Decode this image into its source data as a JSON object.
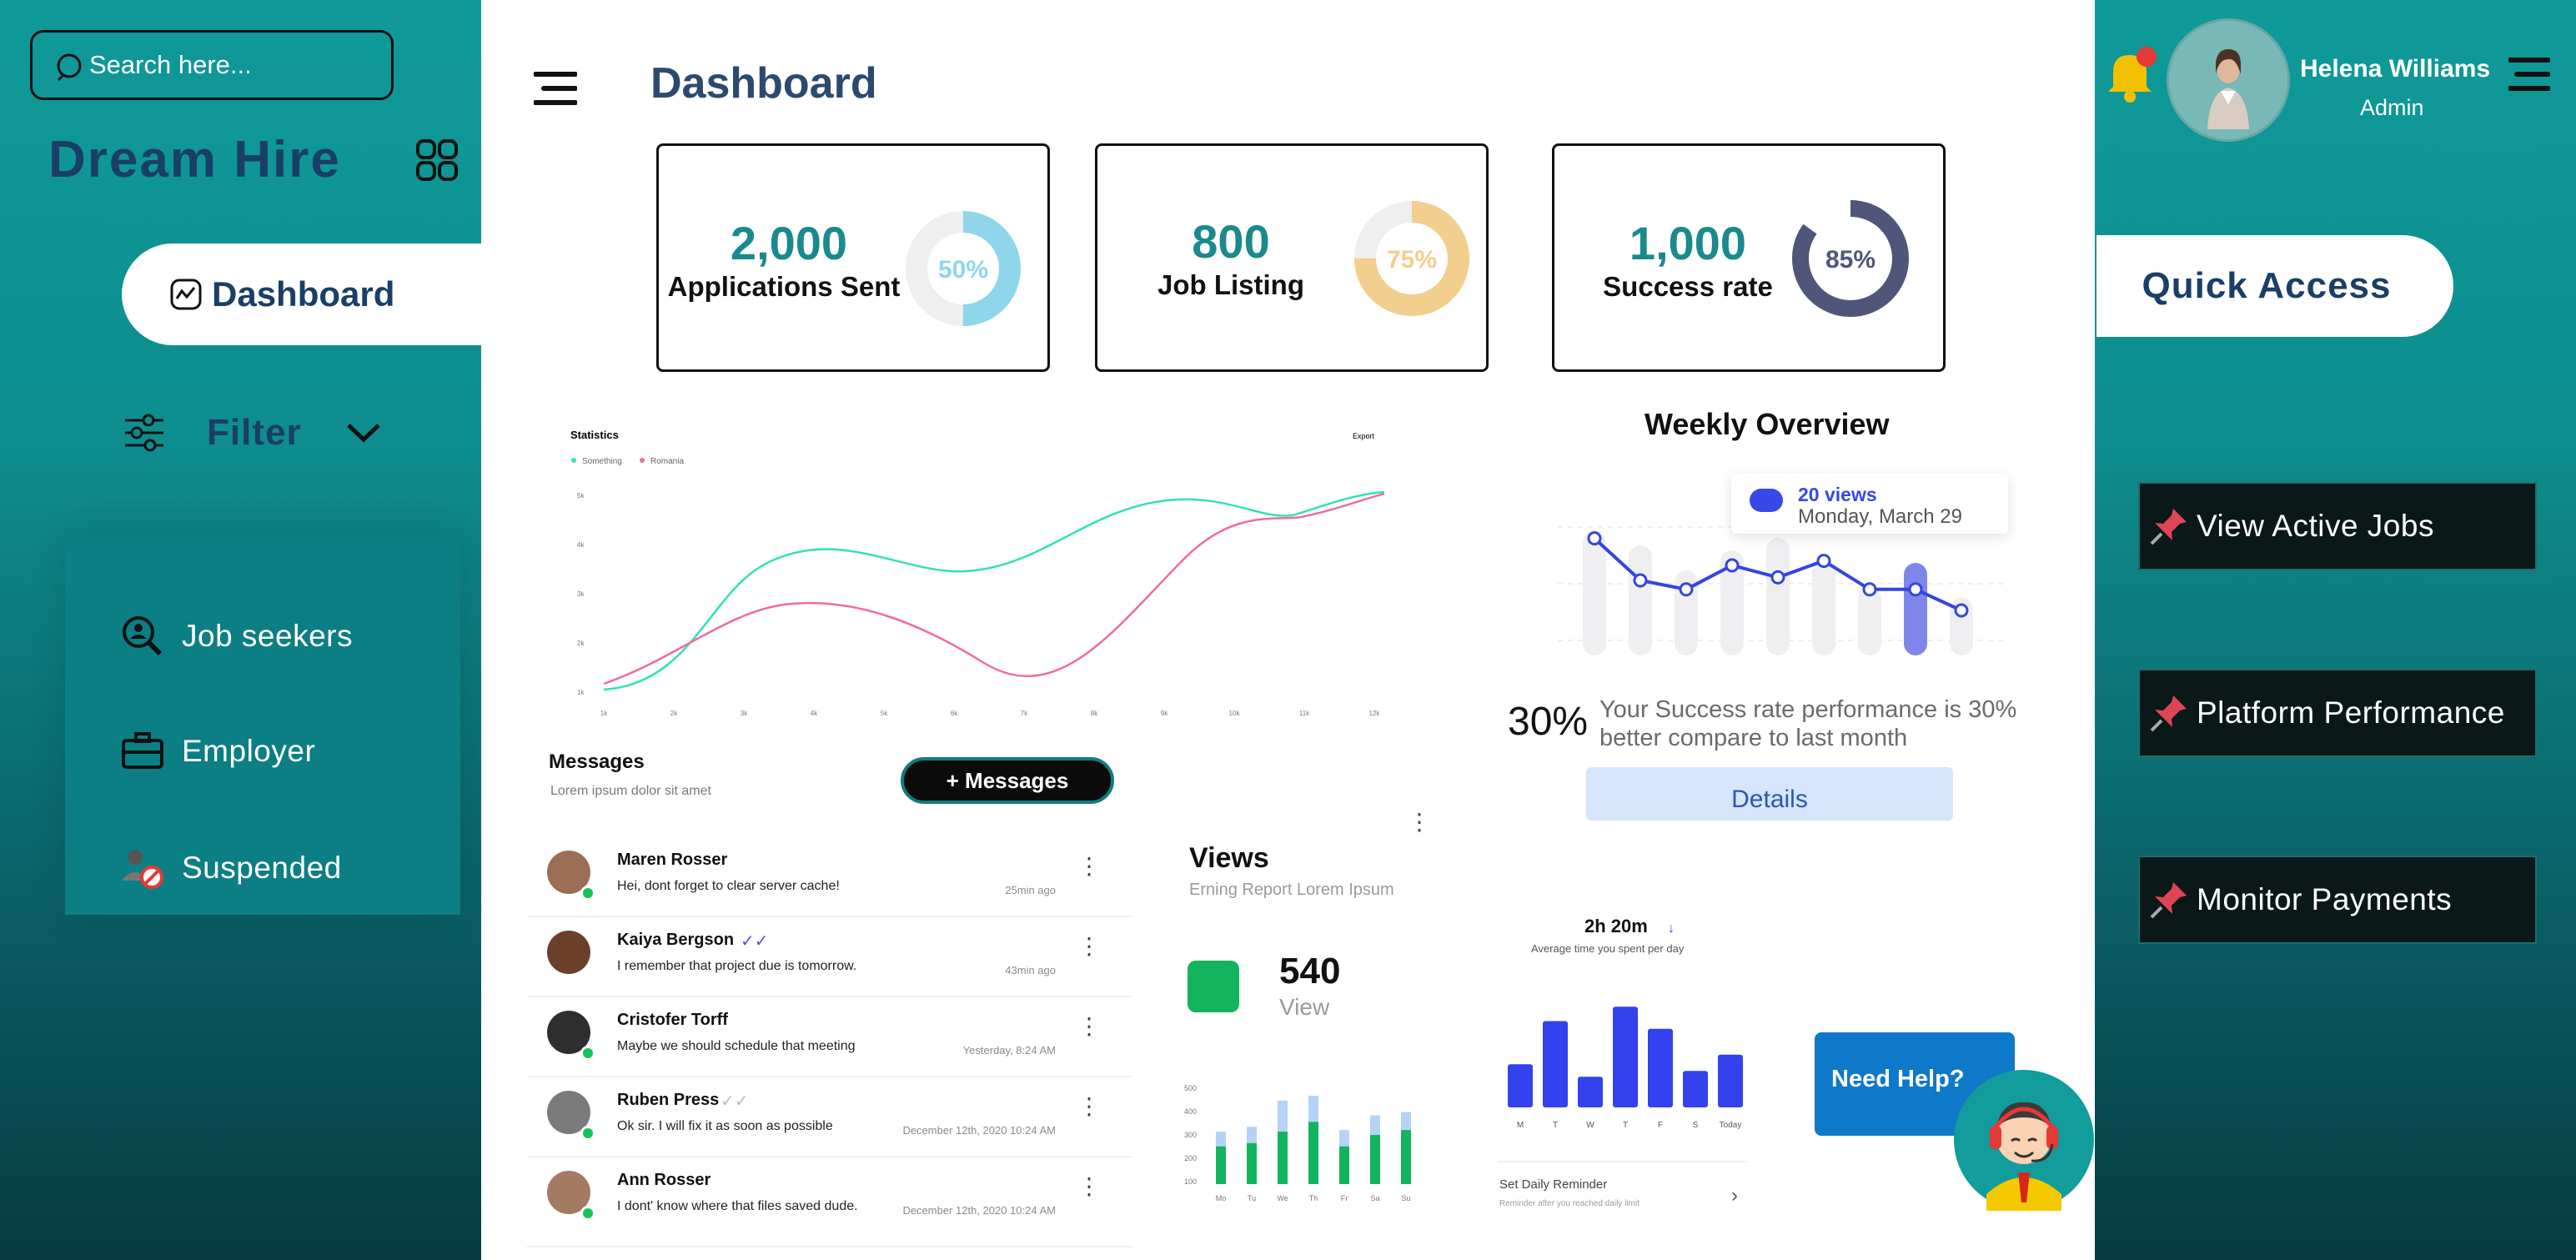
{
  "sidebar": {
    "search_placeholder": "Search here...",
    "brand": "Dream Hire",
    "dashboard_label": "Dashboard",
    "filter_label": "Filter",
    "items": [
      {
        "label": "Job seekers",
        "icon": "search-user-icon"
      },
      {
        "label": "Employer",
        "icon": "briefcase-icon"
      },
      {
        "label": "Suspended",
        "icon": "banned-user-icon"
      }
    ]
  },
  "header": {
    "title": "Dashboard"
  },
  "stats": [
    {
      "value": "2,000",
      "label": "Applications Sent",
      "percent_text": "50%",
      "percent": 50,
      "color": "#8fd6ea"
    },
    {
      "value": "800",
      "label": "Job Listing",
      "percent_text": "75%",
      "percent": 75,
      "color": "#f2cf8e"
    },
    {
      "value": "1,000",
      "label": "Success rate",
      "percent_text": "85%",
      "percent": 85,
      "color": "#4f5679"
    }
  ],
  "statistics": {
    "title": "Statistics",
    "export_label": "Export",
    "legend": [
      "Something",
      "Romania"
    ],
    "colors": [
      "#33e0b8",
      "#f06b9f"
    ],
    "y_ticks": [
      "1k",
      "2k",
      "3k",
      "4k",
      "5k"
    ],
    "x_ticks": [
      "1k",
      "2k",
      "3k",
      "4k",
      "5k",
      "6k",
      "7k",
      "8k",
      "9k",
      "10k",
      "11k",
      "12k"
    ]
  },
  "weekly": {
    "title": "Weekly Overview",
    "tooltip_views": "20 views",
    "tooltip_date": "Monday, March 29",
    "success_pct": "30%",
    "success_text": "Your Success rate performance is 30% better compare to last month",
    "details_label": "Details",
    "line_values": [
      78,
      50,
      44,
      60,
      52,
      63,
      44,
      44,
      30
    ],
    "bar_values": [
      100,
      88,
      68,
      84,
      94,
      76,
      54,
      74,
      46
    ],
    "highlight_index": 7
  },
  "messages": {
    "title": "Messages",
    "subtitle": "Lorem ipsum dolor sit amet",
    "button_label": "+ Messages",
    "rows": [
      {
        "name": "Maren Rosser",
        "text": "Hei, dont forget to clear server cache!",
        "time": "25min ago",
        "check": ""
      },
      {
        "name": "Kaiya Bergson",
        "text": "I remember that project due is tomorrow.",
        "time": "43min ago",
        "check": "✓✓"
      },
      {
        "name": "Cristofer Torff",
        "text": "Maybe we should schedule that meeting",
        "time": "Yesterday, 8:24 AM",
        "check": ""
      },
      {
        "name": "Ruben Press",
        "text": "Ok sir. I will fix it as soon as possible",
        "time": "December 12th, 2020  10:24 AM",
        "check": "✓✓"
      },
      {
        "name": "Ann Rosser",
        "text": "I dont' know where that files saved dude.",
        "time": "December 12th, 2020  10:24 AM",
        "check": ""
      }
    ]
  },
  "views": {
    "title": "Views",
    "subtitle": "Erning Report Lorem Ipsum",
    "value": "540",
    "unit": "View",
    "y_ticks": [
      "500",
      "400",
      "300",
      "200",
      "100"
    ],
    "days": [
      "Mo",
      "Tu",
      "We",
      "Th",
      "Fr",
      "Sa",
      "Su"
    ],
    "dark_values": [
      230,
      250,
      320,
      380,
      230,
      300,
      330
    ],
    "light_values": [
      320,
      350,
      510,
      540,
      330,
      420,
      440
    ]
  },
  "time_spent": {
    "value": "2h 20m",
    "arrow": "↓",
    "subtitle": "Average time you spent per day",
    "days": [
      "M",
      "T",
      "W",
      "T",
      "F",
      "S",
      "Today"
    ],
    "values": [
      45,
      90,
      32,
      105,
      82,
      38,
      55
    ],
    "reminder_title": "Set Daily Reminder",
    "reminder_sub": "Reminder after you reached daily limit"
  },
  "help": {
    "label": "Need Help?"
  },
  "user": {
    "name": "Helena Williams",
    "role": "Admin"
  },
  "quick_access": {
    "title": "Quick Access",
    "items": [
      "View Active Jobs",
      "Platform Performance",
      "Monitor Payments"
    ]
  }
}
